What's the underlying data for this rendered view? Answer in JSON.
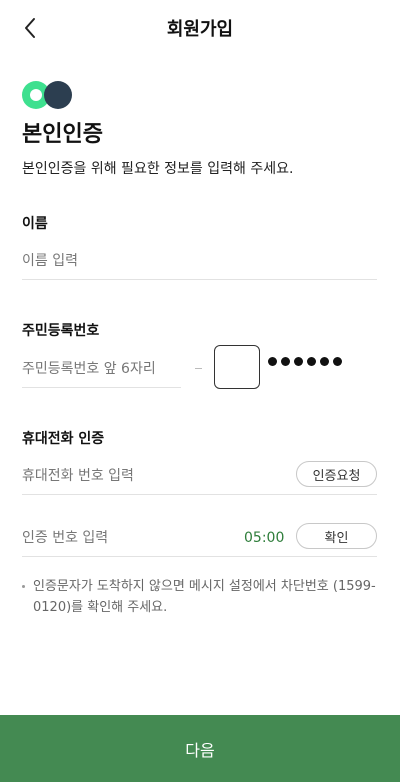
{
  "header": {
    "title": "회원가입"
  },
  "intro": {
    "title": "본인인증",
    "description": "본인인증을 위해 필요한 정보를 입력해 주세요."
  },
  "name_section": {
    "label": "이름",
    "placeholder": "이름 입력"
  },
  "rrn_section": {
    "label": "주민등록번호",
    "front_placeholder": "주민등록번호 앞 6자리",
    "masked_digits": 6
  },
  "phone_section": {
    "label": "휴대전화 인증",
    "phone_placeholder": "휴대전화 번호 입력",
    "request_button": "인증요청",
    "code_placeholder": "인증 번호 입력",
    "timer": "05:00",
    "confirm_button": "확인"
  },
  "notice": {
    "text": "인증문자가 도착하지 않으면 메시지 설정에서 차단번호 (1599-0120)를 확인해 주세요."
  },
  "footer": {
    "next_button": "다음"
  },
  "colors": {
    "primary_green": "#448a52",
    "timer_green": "#2e7d3a",
    "logo_green": "#3ee08f",
    "logo_navy": "#2c3e50"
  }
}
